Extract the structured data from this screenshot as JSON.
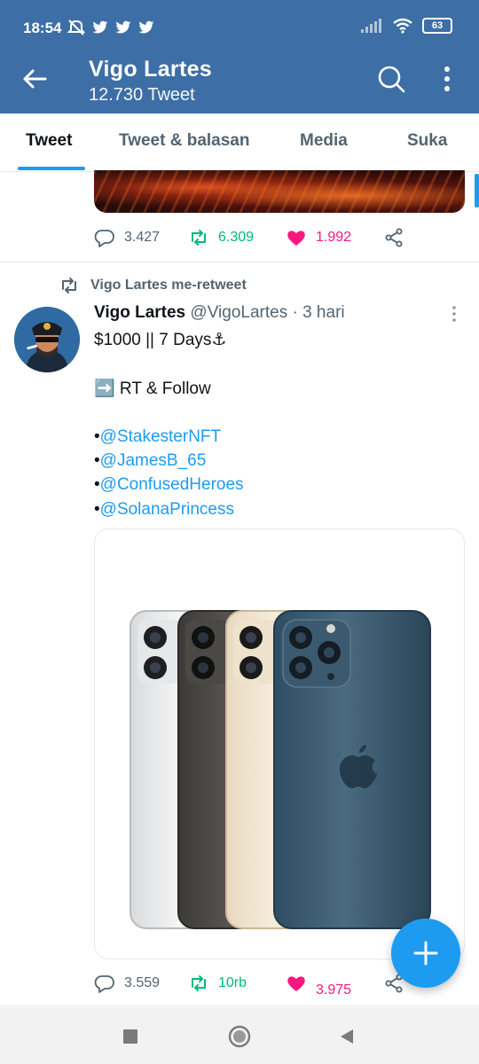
{
  "status_bar": {
    "time": "18:54",
    "battery": "63"
  },
  "header": {
    "title": "Vigo Lartes",
    "subtitle": "12.730 Tweet"
  },
  "tabs": [
    {
      "label": "Tweet",
      "active": true
    },
    {
      "label": "Tweet & balasan",
      "active": false
    },
    {
      "label": "Media",
      "active": false
    },
    {
      "label": "Suka",
      "active": false
    }
  ],
  "previous_tweet": {
    "replies": "3.427",
    "retweets": "6.309",
    "likes": "1.992",
    "liked": true
  },
  "tweet": {
    "retweeted_by": "Vigo Lartes me-retweet",
    "author_name": "Vigo Lartes",
    "author_handle": "@VigoLartes",
    "time": "· 3 hari",
    "line1": "$1000 || 7 Days⚓",
    "line2": "➡️ RT & Follow",
    "mentions": [
      "@StakesterNFT",
      "@JamesB_65",
      "@ConfusedHeroes",
      "@SolanaPrincess"
    ],
    "replies": "3.559",
    "retweets": "10rb",
    "likes": "3.975",
    "liked": true
  },
  "colors": {
    "header_bg": "#3d6fa6",
    "accent": "#1d9bf0",
    "retweet": "#00ba7c",
    "like": "#f91880",
    "secondary_text": "#536471"
  }
}
